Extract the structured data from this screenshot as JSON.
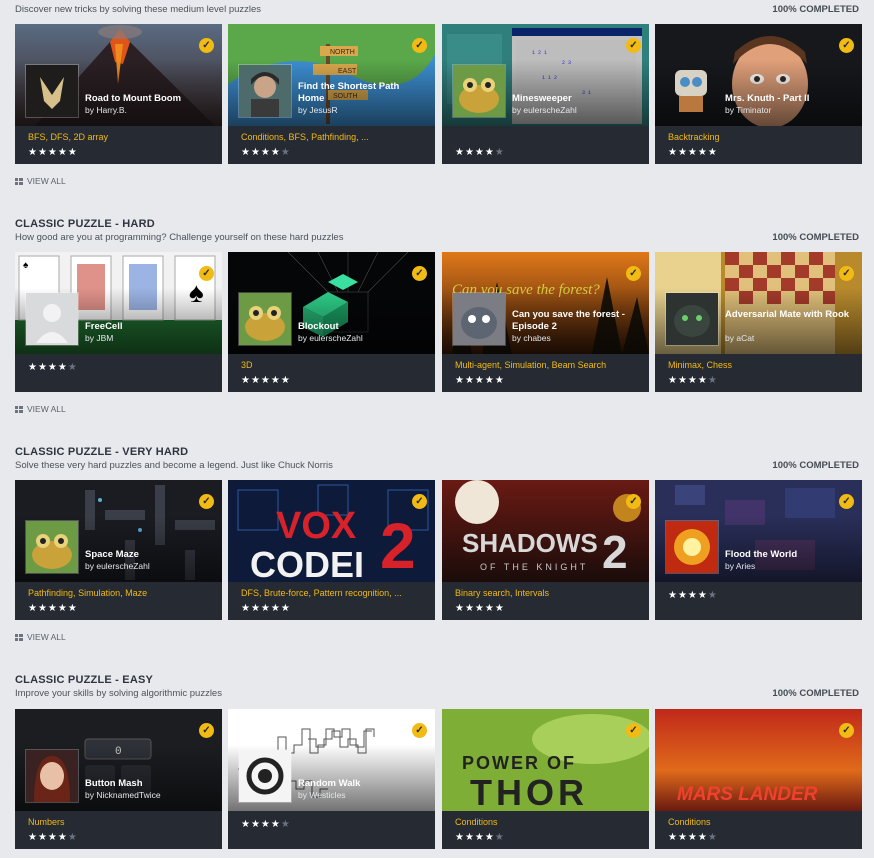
{
  "sections": [
    {
      "title": "",
      "subtitle": "Discover new tricks by solving these medium level puzzles",
      "completed": "100% COMPLETED",
      "view_all": "VIEW ALL",
      "cards": [
        {
          "title": "Road to Mount Boom",
          "author": "by Harry.B.",
          "tags": [
            "BFS",
            "DFS",
            "2D array"
          ],
          "stars": 5,
          "cover": "volcano-cover",
          "avatar": "wolf-logo-avatar"
        },
        {
          "title": "Find the Shortest Path Home",
          "author": "by JesusR",
          "tags": [
            "Conditions",
            "BFS",
            "Pathfinding",
            "..."
          ],
          "stars": 4,
          "cover": "signpost-map-cover",
          "avatar": "girl-avatar"
        },
        {
          "title": "Minesweeper",
          "author": "by eulerscheZahl",
          "tags": [],
          "stars": 4,
          "cover": "minesweeper-cover",
          "avatar": "toad-avatar"
        },
        {
          "title": "Mrs. Knuth - Part II",
          "author": "by Timinator",
          "tags": [
            "Backtracking"
          ],
          "stars": 5,
          "cover": "cartoon-man-cover",
          "avatar": "robot-avatar"
        }
      ]
    },
    {
      "title": "CLASSIC PUZZLE - HARD",
      "subtitle": "How good are you at programming? Challenge yourself on these hard puzzles",
      "completed": "100% COMPLETED",
      "view_all": "VIEW ALL",
      "cards": [
        {
          "title": "FreeCell",
          "author": "by JBM",
          "tags": [],
          "stars": 4,
          "cover": "playing-cards-cover",
          "avatar": "default-avatar"
        },
        {
          "title": "Blockout",
          "author": "by eulerscheZahl",
          "tags": [
            "3D"
          ],
          "stars": 5,
          "cover": "blocks-3d-cover",
          "avatar": "toad-avatar"
        },
        {
          "title": "Can you save the forest - Episode 2",
          "author": "by chabes",
          "tags": [
            "Multi-agent",
            "Simulation",
            "Beam Search"
          ],
          "stars": 5,
          "cover": "forest-fire-cover",
          "avatar": "cat-avatar"
        },
        {
          "title": "Adversarial Mate with Rook",
          "author": "by aCat",
          "tags": [
            "Minimax",
            "Chess"
          ],
          "stars": 4,
          "cover": "chess-board-cover",
          "avatar": "dark-cat-avatar"
        }
      ]
    },
    {
      "title": "CLASSIC PUZZLE - VERY HARD",
      "subtitle": "Solve these very hard puzzles and become a legend. Just like Chuck Norris",
      "completed": "100% COMPLETED",
      "view_all": "VIEW ALL",
      "cards": [
        {
          "title": "Space Maze",
          "author": "by eulerscheZahl",
          "tags": [
            "Pathfinding",
            "Simulation",
            "Maze"
          ],
          "stars": 5,
          "cover": "space-maze-cover",
          "avatar": "toad-avatar"
        },
        {
          "title": "",
          "author": "",
          "tags": [
            "DFS",
            "Brute-force",
            "Pattern recognition",
            "..."
          ],
          "stars": 5,
          "cover": "vox-codei-2-cover",
          "cover_text_1": "VOX",
          "cover_text_2": "CODEI",
          "cover_text_3": "2",
          "avatar": ""
        },
        {
          "title": "",
          "author": "",
          "tags": [
            "Binary search",
            "Intervals"
          ],
          "stars": 5,
          "cover": "shadows-of-the-knight-2-cover",
          "cover_text_1": "SHADOWS",
          "cover_text_2": "2",
          "cover_text_3": "OF THE KNIGHT",
          "avatar": ""
        },
        {
          "title": "Flood the World",
          "author": "by Aries",
          "tags": [],
          "stars": 4,
          "cover": "flood-cover",
          "avatar": "explosion-avatar"
        }
      ]
    },
    {
      "title": "CLASSIC PUZZLE - EASY",
      "subtitle": "Improve your skills by solving algorithmic puzzles",
      "completed": "100% COMPLETED",
      "view_all": "",
      "cards": [
        {
          "title": "Button Mash",
          "author": "by NicknamedTwice",
          "tags": [
            "Numbers"
          ],
          "stars": 4,
          "cover": "button-mash-cover",
          "cover_text_1": "0",
          "avatar": "anime-girl-avatar"
        },
        {
          "title": "Random Walk",
          "author": "by Westicles",
          "tags": [],
          "stars": 4,
          "cover": "random-walk-cover",
          "avatar": "spiral-avatar"
        },
        {
          "title": "",
          "author": "",
          "tags": [
            "Conditions"
          ],
          "stars": 4,
          "cover": "power-of-thor-cover",
          "cover_text_1": "POWER OF",
          "cover_text_2": "THOR",
          "avatar": ""
        },
        {
          "title": "",
          "author": "",
          "tags": [
            "Conditions"
          ],
          "stars": 4,
          "cover": "mars-lander-cover",
          "cover_text_1": "MARS LANDER",
          "avatar": ""
        }
      ]
    }
  ],
  "colors": {
    "accent": "#f2bb13",
    "card_bg": "#252a33",
    "page_bg": "#e8e9ec"
  }
}
